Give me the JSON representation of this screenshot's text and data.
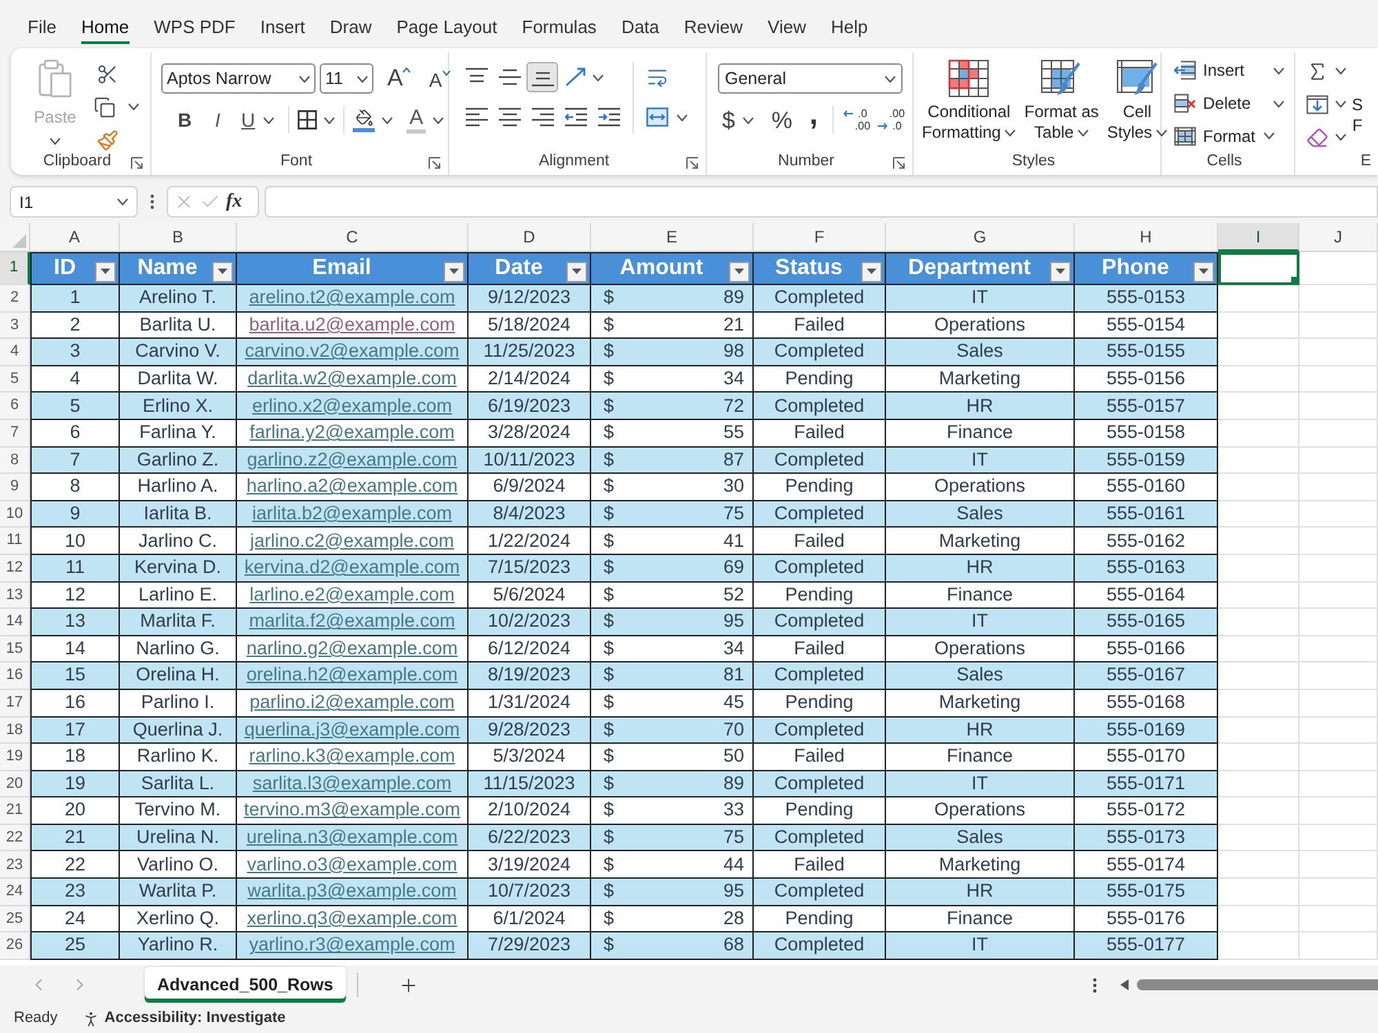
{
  "menu_tabs": [
    {
      "label": "File",
      "selected": false
    },
    {
      "label": "Home",
      "selected": true
    },
    {
      "label": "WPS PDF",
      "selected": false
    },
    {
      "label": "Insert",
      "selected": false
    },
    {
      "label": "Draw",
      "selected": false
    },
    {
      "label": "Page Layout",
      "selected": false
    },
    {
      "label": "Formulas",
      "selected": false
    },
    {
      "label": "Data",
      "selected": false
    },
    {
      "label": "Review",
      "selected": false
    },
    {
      "label": "View",
      "selected": false
    },
    {
      "label": "Help",
      "selected": false
    }
  ],
  "ribbon": {
    "clipboard": {
      "label": "Clipboard",
      "paste": {
        "label": "Paste",
        "disabled": true
      }
    },
    "font": {
      "label": "Font",
      "font_name": "Aptos Narrow",
      "font_size": "11",
      "grow": "A",
      "shrink": "A",
      "bold": "B",
      "italic": "I",
      "underline": "U",
      "font_color": "A"
    },
    "alignment": {
      "label": "Alignment",
      "vertical": [
        {
          "kind": "top",
          "selected": false
        },
        {
          "kind": "middle",
          "selected": false
        },
        {
          "kind": "bottom",
          "selected": true
        }
      ],
      "horizontal": [
        {
          "kind": "left",
          "selected": false
        },
        {
          "kind": "center",
          "selected": false
        },
        {
          "kind": "right",
          "selected": false
        }
      ]
    },
    "number": {
      "label": "Number",
      "format": "General",
      "currency": "$",
      "percent": "%",
      "comma": ",",
      "decimals": [
        {
          "kind": "increase",
          "top": ".0",
          "bottom": ".00"
        },
        {
          "kind": "decrease",
          "top": ".00",
          "bottom": ".0"
        }
      ]
    },
    "styles": {
      "label": "Styles",
      "buttons": [
        {
          "kind": "conditional",
          "lines": [
            "Conditional",
            "Formatting"
          ]
        },
        {
          "kind": "table",
          "lines": [
            "Format as",
            "Table"
          ]
        },
        {
          "kind": "cell_styles",
          "lines": [
            "Cell",
            "Styles"
          ]
        }
      ]
    },
    "cells": {
      "label": "Cells",
      "buttons": [
        {
          "kind": "insert",
          "label": "Insert"
        },
        {
          "kind": "delete",
          "label": "Delete"
        },
        {
          "kind": "format",
          "label": "Format"
        }
      ]
    },
    "editing": {
      "label": "E",
      "sort_filter": [
        "S",
        "F"
      ]
    }
  },
  "formula_bar": {
    "name_box": "I1",
    "function_label": "fx"
  },
  "sheet": {
    "columns": [
      {
        "letter": "A",
        "selected": false
      },
      {
        "letter": "B",
        "selected": false
      },
      {
        "letter": "C",
        "selected": false
      },
      {
        "letter": "D",
        "selected": false
      },
      {
        "letter": "E",
        "selected": false
      },
      {
        "letter": "F",
        "selected": false
      },
      {
        "letter": "G",
        "selected": false
      },
      {
        "letter": "H",
        "selected": false
      },
      {
        "letter": "I",
        "selected": true
      },
      {
        "letter": "J",
        "selected": false
      }
    ],
    "row_numbers": [
      {
        "label": "1",
        "selected": true
      },
      {
        "label": "2",
        "selected": false
      },
      {
        "label": "3",
        "selected": false
      },
      {
        "label": "4",
        "selected": false
      },
      {
        "label": "5",
        "selected": false
      },
      {
        "label": "6",
        "selected": false
      },
      {
        "label": "7",
        "selected": false
      },
      {
        "label": "8",
        "selected": false
      },
      {
        "label": "9",
        "selected": false
      },
      {
        "label": "10",
        "selected": false
      },
      {
        "label": "11",
        "selected": false
      },
      {
        "label": "12",
        "selected": false
      },
      {
        "label": "13",
        "selected": false
      },
      {
        "label": "14",
        "selected": false
      },
      {
        "label": "15",
        "selected": false
      },
      {
        "label": "16",
        "selected": false
      },
      {
        "label": "17",
        "selected": false
      },
      {
        "label": "18",
        "selected": false
      },
      {
        "label": "19",
        "selected": false
      },
      {
        "label": "20",
        "selected": false
      },
      {
        "label": "21",
        "selected": false
      },
      {
        "label": "22",
        "selected": false
      },
      {
        "label": "23",
        "selected": false
      },
      {
        "label": "24",
        "selected": false
      },
      {
        "label": "25",
        "selected": false
      },
      {
        "label": "26",
        "selected": false
      }
    ],
    "table": {
      "columns": [
        "ID",
        "Name",
        "Email",
        "Date",
        "Amount",
        "Status",
        "Department",
        "Phone"
      ],
      "rows": [
        {
          "id": "1",
          "name": "Arelino T.",
          "email": "arelino.t2@example.com",
          "visited": false,
          "date": "9/12/2023",
          "currency": "$",
          "amount": "89",
          "status": "Completed",
          "department": "IT",
          "phone": "555-0153"
        },
        {
          "id": "2",
          "name": "Barlita U.",
          "email": "barlita.u2@example.com",
          "visited": true,
          "date": "5/18/2024",
          "currency": "$",
          "amount": "21",
          "status": "Failed",
          "department": "Operations",
          "phone": "555-0154"
        },
        {
          "id": "3",
          "name": "Carvino V.",
          "email": "carvino.v2@example.com",
          "visited": false,
          "date": "11/25/2023",
          "currency": "$",
          "amount": "98",
          "status": "Completed",
          "department": "Sales",
          "phone": "555-0155"
        },
        {
          "id": "4",
          "name": "Darlita W.",
          "email": "darlita.w2@example.com",
          "visited": false,
          "date": "2/14/2024",
          "currency": "$",
          "amount": "34",
          "status": "Pending",
          "department": "Marketing",
          "phone": "555-0156"
        },
        {
          "id": "5",
          "name": "Erlino X.",
          "email": "erlino.x2@example.com",
          "visited": false,
          "date": "6/19/2023",
          "currency": "$",
          "amount": "72",
          "status": "Completed",
          "department": "HR",
          "phone": "555-0157"
        },
        {
          "id": "6",
          "name": "Farlina Y.",
          "email": "farlina.y2@example.com",
          "visited": false,
          "date": "3/28/2024",
          "currency": "$",
          "amount": "55",
          "status": "Failed",
          "department": "Finance",
          "phone": "555-0158"
        },
        {
          "id": "7",
          "name": "Garlino Z.",
          "email": "garlino.z2@example.com",
          "visited": false,
          "date": "10/11/2023",
          "currency": "$",
          "amount": "87",
          "status": "Completed",
          "department": "IT",
          "phone": "555-0159"
        },
        {
          "id": "8",
          "name": "Harlino A.",
          "email": "harlino.a2@example.com",
          "visited": false,
          "date": "6/9/2024",
          "currency": "$",
          "amount": "30",
          "status": "Pending",
          "department": "Operations",
          "phone": "555-0160"
        },
        {
          "id": "9",
          "name": "Iarlita B.",
          "email": "iarlita.b2@example.com",
          "visited": false,
          "date": "8/4/2023",
          "currency": "$",
          "amount": "75",
          "status": "Completed",
          "department": "Sales",
          "phone": "555-0161"
        },
        {
          "id": "10",
          "name": "Jarlino C.",
          "email": "jarlino.c2@example.com",
          "visited": false,
          "date": "1/22/2024",
          "currency": "$",
          "amount": "41",
          "status": "Failed",
          "department": "Marketing",
          "phone": "555-0162"
        },
        {
          "id": "11",
          "name": "Kervina D.",
          "email": "kervina.d2@example.com",
          "visited": false,
          "date": "7/15/2023",
          "currency": "$",
          "amount": "69",
          "status": "Completed",
          "department": "HR",
          "phone": "555-0163"
        },
        {
          "id": "12",
          "name": "Larlino E.",
          "email": "larlino.e2@example.com",
          "visited": false,
          "date": "5/6/2024",
          "currency": "$",
          "amount": "52",
          "status": "Pending",
          "department": "Finance",
          "phone": "555-0164"
        },
        {
          "id": "13",
          "name": "Marlita F.",
          "email": "marlita.f2@example.com",
          "visited": false,
          "date": "10/2/2023",
          "currency": "$",
          "amount": "95",
          "status": "Completed",
          "department": "IT",
          "phone": "555-0165"
        },
        {
          "id": "14",
          "name": "Narlino G.",
          "email": "narlino.g2@example.com",
          "visited": false,
          "date": "6/12/2024",
          "currency": "$",
          "amount": "34",
          "status": "Failed",
          "department": "Operations",
          "phone": "555-0166"
        },
        {
          "id": "15",
          "name": "Orelina H.",
          "email": "orelina.h2@example.com",
          "visited": false,
          "date": "8/19/2023",
          "currency": "$",
          "amount": "81",
          "status": "Completed",
          "department": "Sales",
          "phone": "555-0167"
        },
        {
          "id": "16",
          "name": "Parlino I.",
          "email": "parlino.i2@example.com",
          "visited": false,
          "date": "1/31/2024",
          "currency": "$",
          "amount": "45",
          "status": "Pending",
          "department": "Marketing",
          "phone": "555-0168"
        },
        {
          "id": "17",
          "name": "Querlina J.",
          "email": "querlina.j3@example.com",
          "visited": false,
          "date": "9/28/2023",
          "currency": "$",
          "amount": "70",
          "status": "Completed",
          "department": "HR",
          "phone": "555-0169"
        },
        {
          "id": "18",
          "name": "Rarlino K.",
          "email": "rarlino.k3@example.com",
          "visited": false,
          "date": "5/3/2024",
          "currency": "$",
          "amount": "50",
          "status": "Failed",
          "department": "Finance",
          "phone": "555-0170"
        },
        {
          "id": "19",
          "name": "Sarlita L.",
          "email": "sarlita.l3@example.com",
          "visited": false,
          "date": "11/15/2023",
          "currency": "$",
          "amount": "89",
          "status": "Completed",
          "department": "IT",
          "phone": "555-0171"
        },
        {
          "id": "20",
          "name": "Tervino M.",
          "email": "tervino.m3@example.com",
          "visited": false,
          "date": "2/10/2024",
          "currency": "$",
          "amount": "33",
          "status": "Pending",
          "department": "Operations",
          "phone": "555-0172"
        },
        {
          "id": "21",
          "name": "Urelina N.",
          "email": "urelina.n3@example.com",
          "visited": false,
          "date": "6/22/2023",
          "currency": "$",
          "amount": "75",
          "status": "Completed",
          "department": "Sales",
          "phone": "555-0173"
        },
        {
          "id": "22",
          "name": "Varlino O.",
          "email": "varlino.o3@example.com",
          "visited": false,
          "date": "3/19/2024",
          "currency": "$",
          "amount": "44",
          "status": "Failed",
          "department": "Marketing",
          "phone": "555-0174"
        },
        {
          "id": "23",
          "name": "Warlita P.",
          "email": "warlita.p3@example.com",
          "visited": false,
          "date": "10/7/2023",
          "currency": "$",
          "amount": "95",
          "status": "Completed",
          "department": "HR",
          "phone": "555-0175"
        },
        {
          "id": "24",
          "name": "Xerlino Q.",
          "email": "xerlino.q3@example.com",
          "visited": false,
          "date": "6/1/2024",
          "currency": "$",
          "amount": "28",
          "status": "Pending",
          "department": "Finance",
          "phone": "555-0176"
        },
        {
          "id": "25",
          "name": "Yarlino R.",
          "email": "yarlino.r3@example.com",
          "visited": false,
          "date": "7/29/2023",
          "currency": "$",
          "amount": "68",
          "status": "Completed",
          "department": "IT",
          "phone": "555-0177"
        }
      ]
    }
  },
  "sheet_tabs": [
    {
      "label": "Advanced_500_Rows",
      "selected": true
    }
  ],
  "status_bar": {
    "mode": "Ready",
    "accessibility": "Accessibility: Investigate"
  }
}
